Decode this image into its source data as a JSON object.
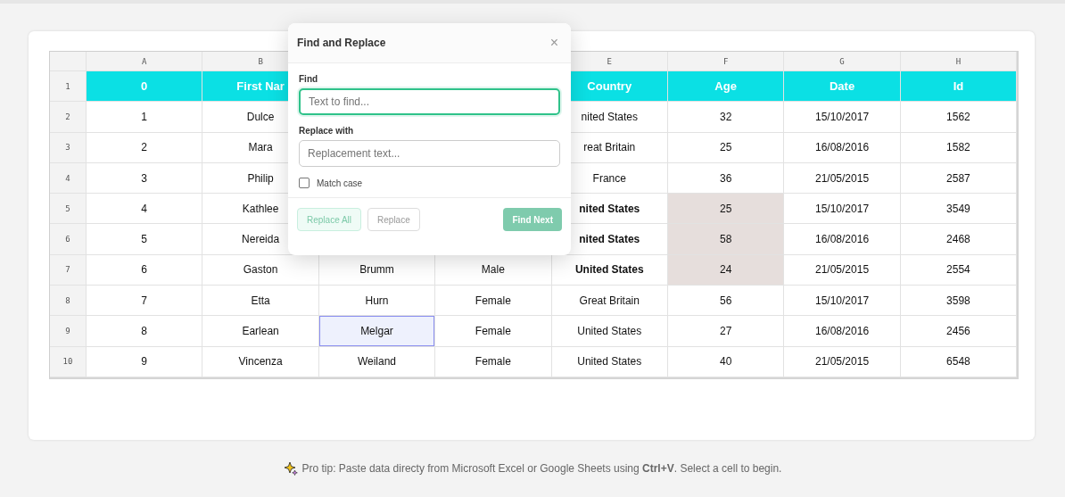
{
  "table": {
    "columns": [
      "A",
      "B",
      null,
      null,
      "E",
      "F",
      "G",
      "H"
    ],
    "header_row": {
      "number": "1",
      "cells": [
        "0",
        "First Nar",
        null,
        null,
        "Country",
        "Age",
        "Date",
        "Id"
      ]
    },
    "rows": [
      {
        "number": "2",
        "cells": [
          {
            "text": "1",
            "kind": "plain"
          },
          {
            "text": "Dulce",
            "kind": "plain"
          },
          null,
          null,
          {
            "text": "nited States",
            "kind": "plain"
          },
          {
            "text": "32",
            "kind": "plain"
          },
          {
            "text": "15/10/2017",
            "kind": "plain"
          },
          {
            "text": "1562",
            "kind": "plain"
          }
        ]
      },
      {
        "number": "3",
        "cells": [
          {
            "text": "2",
            "kind": "plain"
          },
          {
            "text": "Mara",
            "kind": "plain"
          },
          null,
          null,
          {
            "text": "reat Britain",
            "kind": "plain"
          },
          {
            "text": "25",
            "kind": "plain"
          },
          {
            "text": "16/08/2016",
            "kind": "plain"
          },
          {
            "text": "1582",
            "kind": "plain"
          }
        ]
      },
      {
        "number": "4",
        "cells": [
          {
            "text": "3",
            "kind": "plain"
          },
          {
            "text": "Philip",
            "kind": "plain"
          },
          null,
          null,
          {
            "text": "France",
            "kind": "plain"
          },
          {
            "text": "36",
            "kind": "plain"
          },
          {
            "text": "21/05/2015",
            "kind": "plain"
          },
          {
            "text": "2587",
            "kind": "plain"
          }
        ]
      },
      {
        "number": "5",
        "cells": [
          {
            "text": "4",
            "kind": "plain"
          },
          {
            "text": "Kathlee",
            "kind": "plain"
          },
          null,
          null,
          {
            "text": "nited States",
            "kind": "bold"
          },
          {
            "text": "25",
            "kind": "highlight"
          },
          {
            "text": "15/10/2017",
            "kind": "plain"
          },
          {
            "text": "3549",
            "kind": "plain"
          }
        ]
      },
      {
        "number": "6",
        "cells": [
          {
            "text": "5",
            "kind": "plain"
          },
          {
            "text": "Nereida",
            "kind": "plain"
          },
          null,
          null,
          {
            "text": "nited States",
            "kind": "bold"
          },
          {
            "text": "58",
            "kind": "highlight"
          },
          {
            "text": "16/08/2016",
            "kind": "plain"
          },
          {
            "text": "2468",
            "kind": "plain"
          }
        ]
      },
      {
        "number": "7",
        "cells": [
          {
            "text": "6",
            "kind": "plain"
          },
          {
            "text": "Gaston",
            "kind": "plain"
          },
          {
            "text": "Brumm",
            "kind": "plain"
          },
          {
            "text": "Male",
            "kind": "plain"
          },
          {
            "text": "United States",
            "kind": "bold"
          },
          {
            "text": "24",
            "kind": "highlight"
          },
          {
            "text": "21/05/2015",
            "kind": "plain"
          },
          {
            "text": "2554",
            "kind": "plain"
          }
        ]
      },
      {
        "number": "8",
        "cells": [
          {
            "text": "7",
            "kind": "plain"
          },
          {
            "text": "Etta",
            "kind": "plain"
          },
          {
            "text": "Hurn",
            "kind": "plain"
          },
          {
            "text": "Female",
            "kind": "plain"
          },
          {
            "text": "Great Britain",
            "kind": "plain"
          },
          {
            "text": "56",
            "kind": "plain"
          },
          {
            "text": "15/10/2017",
            "kind": "plain"
          },
          {
            "text": "3598",
            "kind": "plain"
          }
        ]
      },
      {
        "number": "9",
        "cells": [
          {
            "text": "8",
            "kind": "plain"
          },
          {
            "text": "Earlean",
            "kind": "plain"
          },
          {
            "text": "Melgar",
            "kind": "selected"
          },
          {
            "text": "Female",
            "kind": "plain"
          },
          {
            "text": "United States",
            "kind": "plain"
          },
          {
            "text": "27",
            "kind": "plain"
          },
          {
            "text": "16/08/2016",
            "kind": "plain"
          },
          {
            "text": "2456",
            "kind": "plain"
          }
        ]
      },
      {
        "number": "10",
        "cells": [
          {
            "text": "9",
            "kind": "plain"
          },
          {
            "text": "Vincenza",
            "kind": "plain"
          },
          {
            "text": "Weiland",
            "kind": "plain"
          },
          {
            "text": "Female",
            "kind": "plain"
          },
          {
            "text": "United States",
            "kind": "plain"
          },
          {
            "text": "40",
            "kind": "plain"
          },
          {
            "text": "21/05/2015",
            "kind": "plain"
          },
          {
            "text": "6548",
            "kind": "plain"
          }
        ]
      }
    ]
  },
  "dialog": {
    "title": "Find and Replace",
    "close": "×",
    "find": {
      "label": "Find",
      "placeholder": "Text to find...",
      "focused": true
    },
    "replace": {
      "label": "Replace with",
      "placeholder": "Replacement text..."
    },
    "match_case": {
      "label": "Match case",
      "checked": false
    },
    "buttons": [
      {
        "label": "Replace All",
        "kind": "soft"
      },
      {
        "label": "Replace",
        "kind": "outline"
      },
      {
        "label": "Find Next",
        "kind": "primary"
      }
    ]
  },
  "tip": "Pro tip: Paste data directy from Microsoft Excel or Google Sheets using **Ctrl+V**. Select a cell to begin."
}
